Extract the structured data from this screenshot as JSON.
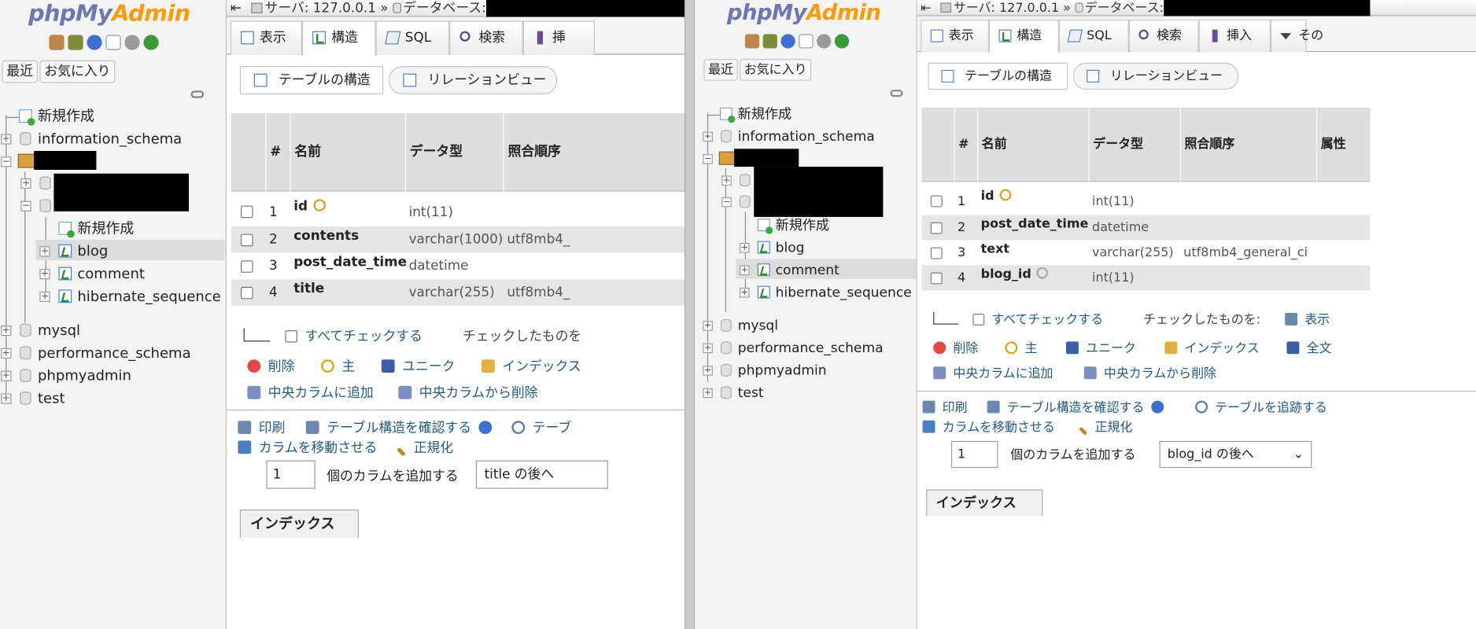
{
  "left_pane": {
    "logo": {
      "php": "php",
      "my": "My",
      "admin": "Admin"
    },
    "nav_buttons": {
      "recent": "最近",
      "favorites": "お気に入り"
    },
    "tree": {
      "new": "新規作成",
      "databases": [
        "information_schema",
        "mysql",
        "performance_schema",
        "phpmyadmin",
        "test"
      ],
      "subtree_new": "新規作成",
      "tables": [
        "blog",
        "comment",
        "hibernate_sequence"
      ],
      "selected_table": "blog"
    },
    "breadcrumb": {
      "server_label": "サーバ: 127.0.0.1",
      "sep": "»",
      "db_label": "データベース:"
    },
    "tabs": [
      "表示",
      "構造",
      "SQL",
      "検索",
      "挿"
    ],
    "active_tab": "構造",
    "subtabs": [
      "テーブルの構造",
      "リレーションビュー"
    ],
    "table_headers": [
      "#",
      "名前",
      "データ型",
      "照合順序"
    ],
    "rows": [
      {
        "num": "1",
        "name": "id",
        "type": "int(11)",
        "collation": "",
        "key": "primary"
      },
      {
        "num": "2",
        "name": "contents",
        "type": "varchar(1000)",
        "collation": "utf8mb4_",
        "key": ""
      },
      {
        "num": "3",
        "name": "post_date_time",
        "type": "datetime",
        "collation": "",
        "key": ""
      },
      {
        "num": "4",
        "name": "title",
        "type": "varchar(255)",
        "collation": "utf8mb4_",
        "key": ""
      }
    ],
    "check_all": "すべてチェックする",
    "with_selected": "チェックしたものを",
    "actions": {
      "drop": "削除",
      "primary": "主",
      "unique": "ユニーク",
      "index": "インデックス",
      "add_central": "中央カラムに追加",
      "remove_central": "中央カラムから削除"
    },
    "bottom_links": {
      "print": "印刷",
      "propose": "テーブル構造を確認する",
      "track": "テーブ",
      "move": "カラムを移動させる",
      "normalize": "正規化"
    },
    "add_column": {
      "count": "1",
      "label": "個のカラムを追加する",
      "position": "title の後へ"
    },
    "index_label": "インデックス"
  },
  "right_pane": {
    "logo": {
      "php": "php",
      "my": "My",
      "admin": "Admin"
    },
    "nav_buttons": {
      "recent": "最近",
      "favorites": "お気に入り"
    },
    "tree": {
      "new": "新規作成",
      "databases": [
        "information_schema",
        "mysql",
        "performance_schema",
        "phpmyadmin",
        "test"
      ],
      "subtree_new": "新規作成",
      "tables": [
        "blog",
        "comment",
        "hibernate_sequence"
      ],
      "selected_table": "comment"
    },
    "breadcrumb": {
      "server_label": "サーバ: 127.0.0.1",
      "sep": "»",
      "db_label": "データベース:"
    },
    "tabs": [
      "表示",
      "構造",
      "SQL",
      "検索",
      "挿入",
      "その"
    ],
    "active_tab": "構造",
    "subtabs": [
      "テーブルの構造",
      "リレーションビュー"
    ],
    "table_headers": [
      "#",
      "名前",
      "データ型",
      "照合順序",
      "属性"
    ],
    "rows": [
      {
        "num": "1",
        "name": "id",
        "type": "int(11)",
        "collation": "",
        "key": "primary"
      },
      {
        "num": "2",
        "name": "post_date_time",
        "type": "datetime",
        "collation": "",
        "key": ""
      },
      {
        "num": "3",
        "name": "text",
        "type": "varchar(255)",
        "collation": "utf8mb4_general_ci",
        "key": ""
      },
      {
        "num": "4",
        "name": "blog_id",
        "type": "int(11)",
        "collation": "",
        "key": "index"
      }
    ],
    "check_all": "すべてチェックする",
    "with_selected": "チェックしたものを:",
    "browse_action": "表示",
    "actions": {
      "drop": "削除",
      "primary": "主",
      "unique": "ユニーク",
      "index": "インデックス",
      "fulltext": "全文",
      "add_central": "中央カラムに追加",
      "remove_central": "中央カラムから削除"
    },
    "bottom_links": {
      "print": "印刷",
      "propose": "テーブル構造を確認する",
      "track": "テーブルを追跡する",
      "move": "カラムを移動させる",
      "normalize": "正規化"
    },
    "add_column": {
      "count": "1",
      "label": "個のカラムを追加する",
      "position": "blog_id の後へ"
    },
    "index_label": "インデックス"
  }
}
